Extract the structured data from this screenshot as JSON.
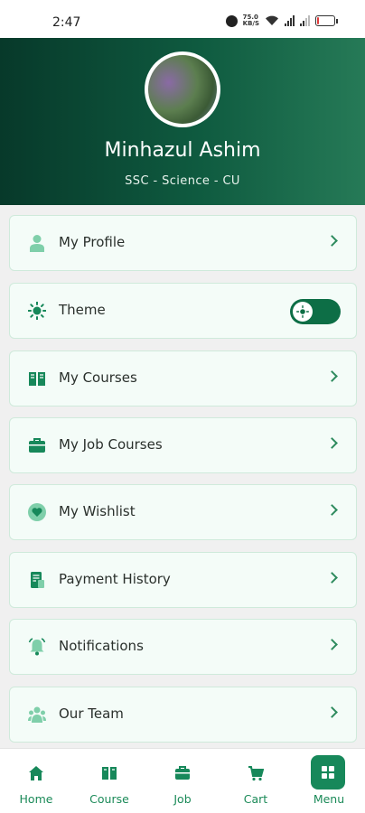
{
  "status_bar": {
    "time": "2:47",
    "net_speed_top": "75.0",
    "net_speed_bottom": "KB/S",
    "battery": "12",
    "icons": [
      "alarm-icon",
      "network-speed",
      "wifi-icon",
      "signal-icon",
      "signal-icon",
      "battery-icon"
    ]
  },
  "profile": {
    "name": "Minhazul Ashim",
    "subtitle": "SSC - Science - CU",
    "avatar": "profile-photo"
  },
  "menu": [
    {
      "label": "My Profile",
      "icon": "person-icon",
      "action": "chevron"
    },
    {
      "label": "Theme",
      "icon": "sun-icon",
      "action": "toggle",
      "toggle_on": true
    },
    {
      "label": "My Courses",
      "icon": "book-icon",
      "action": "chevron"
    },
    {
      "label": "My Job Courses",
      "icon": "briefcase-icon",
      "action": "chevron"
    },
    {
      "label": "My Wishlist",
      "icon": "heart-icon",
      "action": "chevron"
    },
    {
      "label": "Payment History",
      "icon": "receipt-icon",
      "action": "chevron"
    },
    {
      "label": "Notifications",
      "icon": "bell-icon",
      "action": "chevron"
    },
    {
      "label": "Our Team",
      "icon": "group-icon",
      "action": "chevron"
    }
  ],
  "bottom_nav": [
    {
      "label": "Home",
      "icon": "home-icon",
      "active": false
    },
    {
      "label": "Course",
      "icon": "book-icon",
      "active": false
    },
    {
      "label": "Job",
      "icon": "briefcase-icon",
      "active": false
    },
    {
      "label": "Cart",
      "icon": "cart-icon",
      "active": false
    },
    {
      "label": "Menu",
      "icon": "grid-icon",
      "active": true
    }
  ],
  "colors": {
    "accent": "#17885a",
    "header_dark": "#07392a",
    "header_light": "#267a57",
    "card_bg": "#f4fcf8",
    "icon_light": "#7fcfaa"
  }
}
